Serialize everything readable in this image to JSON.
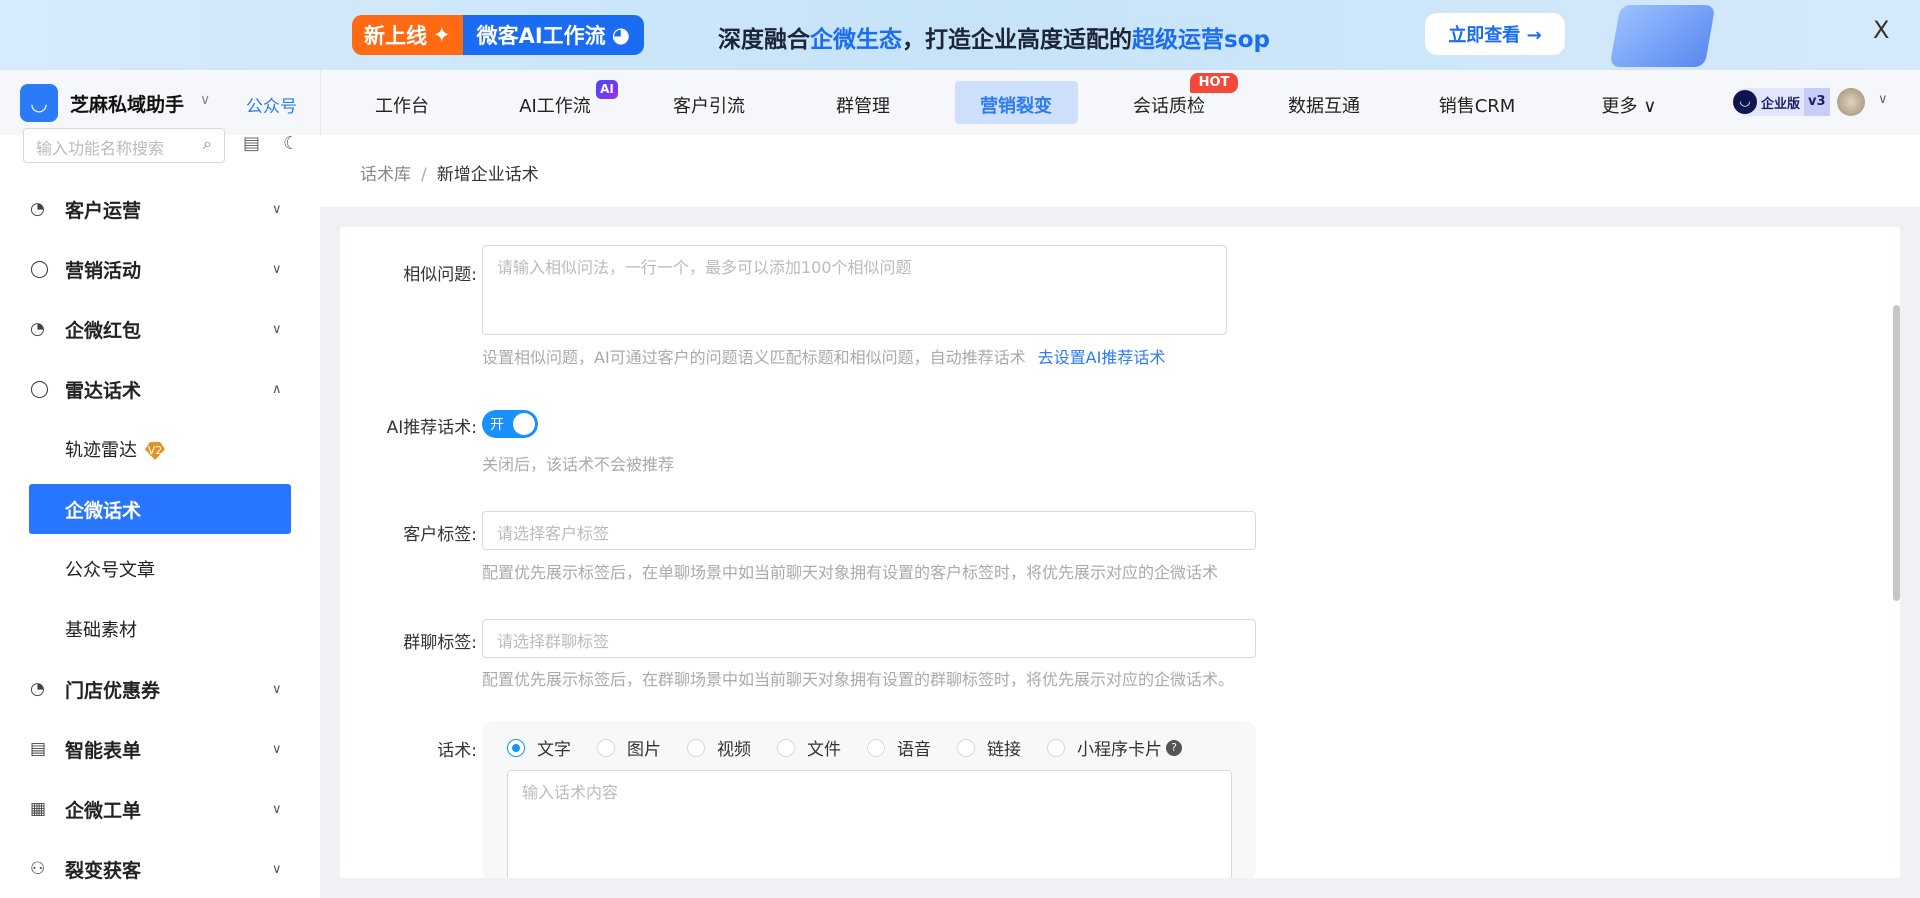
{
  "banner": {
    "tag_new": "新上线",
    "tag_product": "微客AI工作流",
    "slogan_1": "深度融合",
    "slogan_hl1": "企微生态",
    "slogan_2": "，打造企业高度适配的",
    "slogan_hl2": "超级运营sop",
    "cta": "立即查看 →",
    "close": "X"
  },
  "header": {
    "brand": "芝麻私域助手",
    "account_link": "公众号",
    "nav": [
      {
        "label": "工作台"
      },
      {
        "label": "AI工作流",
        "badge": "AI"
      },
      {
        "label": "客户引流"
      },
      {
        "label": "群管理"
      },
      {
        "label": "营销裂变",
        "active": true
      },
      {
        "label": "会话质检",
        "badge": "HOT"
      },
      {
        "label": "数据互通"
      },
      {
        "label": "销售CRM"
      },
      {
        "label": "更多 ∨"
      }
    ],
    "edition": "企业版",
    "edition_version": "v3"
  },
  "sidebar": {
    "search_placeholder": "输入功能名称搜索",
    "items": [
      {
        "label": "客户运营"
      },
      {
        "label": "营销活动"
      },
      {
        "label": "企微红包"
      },
      {
        "label": "雷达话术"
      },
      {
        "label": "轨迹雷达",
        "badge": "V2"
      },
      {
        "label": "企微话术",
        "active": true
      },
      {
        "label": "公众号文章"
      },
      {
        "label": "基础素材"
      },
      {
        "label": "门店优惠券"
      },
      {
        "label": "智能表单"
      },
      {
        "label": "企微工单"
      },
      {
        "label": "裂变获客"
      }
    ]
  },
  "breadcrumb": {
    "parent": "话术库",
    "separator": "/",
    "current": "新增企业话术"
  },
  "form": {
    "similar": {
      "label": "相似问题:",
      "placeholder": "请输入相似问法，一行一个，最多可以添加100个相似问题",
      "help": "设置相似问题，AI可通过客户的问题语义匹配标题和相似问题，自动推荐话术",
      "link": "去设置AI推荐话术"
    },
    "ai_recommend": {
      "label": "AI推荐话术:",
      "toggle_text": "开",
      "enabled": true,
      "help": "关闭后，该话术不会被推荐"
    },
    "customer_tag": {
      "label": "客户标签:",
      "placeholder": "请选择客户标签",
      "help": "配置优先展示标签后，在单聊场景中如当前聊天对象拥有设置的客户标签时，将优先展示对应的企微话术"
    },
    "group_tag": {
      "label": "群聊标签:",
      "placeholder": "请选择群聊标签",
      "help": "配置优先展示标签后，在群聊场景中如当前聊天对象拥有设置的群聊标签时，将优先展示对应的企微话术。"
    },
    "script": {
      "label": "话术:",
      "types": [
        "文字",
        "图片",
        "视频",
        "文件",
        "语音",
        "链接",
        "小程序卡片"
      ],
      "selected": "文字",
      "placeholder": "输入话术内容",
      "help_icon": "?"
    }
  }
}
